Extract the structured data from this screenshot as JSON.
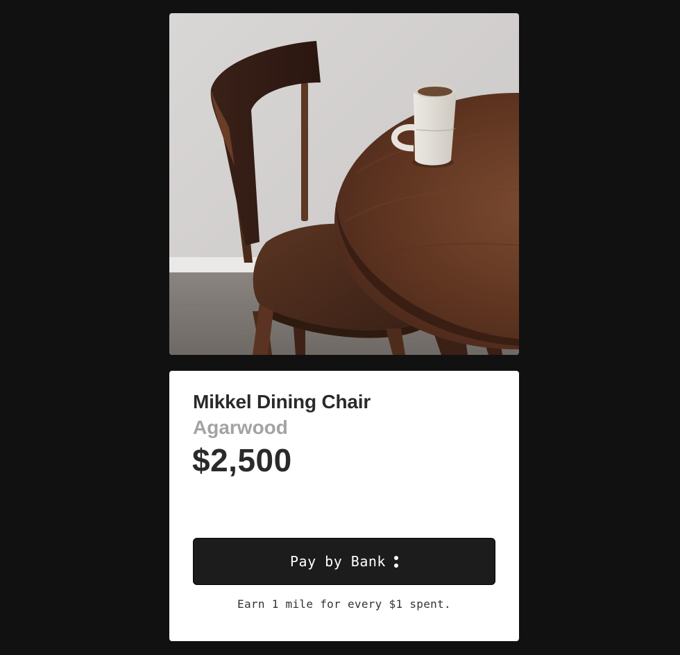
{
  "product": {
    "image_alt": "Wooden dining chair next to round wooden table with a ceramic mug",
    "name": "Mikkel Dining Chair",
    "variant": "Agarwood",
    "price": "$2,500"
  },
  "payment": {
    "button_label": "Pay by Bank",
    "button_icon": "dots-icon",
    "rewards_note": "Earn 1 mile for every $1 spent."
  },
  "colors": {
    "page_background": "#111111",
    "card_background": "#ffffff",
    "button_background": "#1c1c1c",
    "variant_text": "#a3a3a3"
  }
}
